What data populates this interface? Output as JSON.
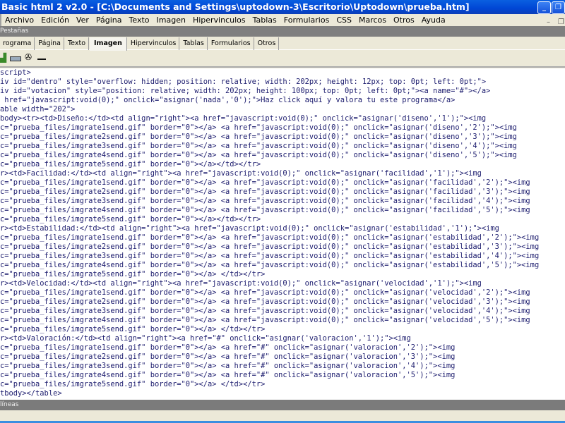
{
  "window": {
    "title": "Basic html 2 v2.0 - [C:\\Documents and Settings\\uptodown-3\\Escritorio\\Uptodown\\prueba.htm]"
  },
  "menu": [
    "Archivo",
    "Edición",
    "Ver",
    "Página",
    "Texto",
    "Imagen",
    "Hipervinculos",
    "Tablas",
    "Formularios",
    "CSS",
    "Marcos",
    "Otros",
    "Ayuda"
  ],
  "panel_title": "Pestañas",
  "tabs": [
    {
      "label": "rograma"
    },
    {
      "label": "Página"
    },
    {
      "label": "Texto"
    },
    {
      "label": "Imagen",
      "active": true
    },
    {
      "label": "Hipervinculos"
    },
    {
      "label": "Tablas"
    },
    {
      "label": "Formularios"
    },
    {
      "label": "Otros"
    }
  ],
  "toolbar_icons": [
    "insert-image-icon",
    "button-icon",
    "camera-icon",
    "horizontal-rule-icon"
  ],
  "code_lines": [
    "script>",
    "iv id=\"dentro\" style=\"overflow: hidden; position: relative; width: 202px; height: 12px; top: 0pt; left: 0pt;\">",
    "iv id=\"votacion\" style=\"position: relative; width: 202px; height: 100px; top: 0pt; left: 0pt;\"><a name=\"#\"></a>",
    " href=\"javascript:void(0);\" onclick=\"asignar('nada','0');\">Haz click aquí y valora tu este programa</a>",
    "able width=\"202\">",
    "body><tr><td>Diseño:</td><td align=\"right\"><a href=\"javascript:void(0);\" onclick=\"asignar('diseno','1');\"><img",
    "c=\"prueba_files/imgrate1send.gif\" border=\"0\"></a> <a href=\"javascript:void(0);\" onclick=\"asignar('diseno','2');\"><img",
    "c=\"prueba_files/imgrate2send.gif\" border=\"0\"></a> <a href=\"javascript:void(0);\" onclick=\"asignar('diseno','3');\"><img",
    "c=\"prueba_files/imgrate3send.gif\" border=\"0\"></a> <a href=\"javascript:void(0);\" onclick=\"asignar('diseno','4');\"><img",
    "c=\"prueba_files/imgrate4send.gif\" border=\"0\"></a> <a href=\"javascript:void(0);\" onclick=\"asignar('diseno','5');\"><img",
    "c=\"prueba_files/imgrate5send.gif\" border=\"0\"></a></td></tr>",
    "r><td>Facilidad:</td><td align=\"right\"><a href=\"javascript:void(0);\" onclick=\"asignar('facilidad','1');\"><img",
    "c=\"prueba_files/imgrate1send.gif\" border=\"0\"></a> <a href=\"javascript:void(0);\" onclick=\"asignar('facilidad','2');\"><img",
    "c=\"prueba_files/imgrate2send.gif\" border=\"0\"></a> <a href=\"javascript:void(0);\" onclick=\"asignar('facilidad','3');\"><img",
    "c=\"prueba_files/imgrate3send.gif\" border=\"0\"></a> <a href=\"javascript:void(0);\" onclick=\"asignar('facilidad','4');\"><img",
    "c=\"prueba_files/imgrate4send.gif\" border=\"0\"></a> <a href=\"javascript:void(0);\" onclick=\"asignar('facilidad','5');\"><img",
    "c=\"prueba_files/imgrate5send.gif\" border=\"0\"></a></td></tr>",
    "r><td>Estabilidad:</td><td align=\"right\"><a href=\"javascript:void(0);\" onclick=\"asignar('estabilidad','1');\"><img",
    "c=\"prueba_files/imgrate1send.gif\" border=\"0\"></a> <a href=\"javascript:void(0);\" onclick=\"asignar('estabilidad','2');\"><img",
    "c=\"prueba_files/imgrate2send.gif\" border=\"0\"></a> <a href=\"javascript:void(0);\" onclick=\"asignar('estabilidad','3');\"><img",
    "c=\"prueba_files/imgrate3send.gif\" border=\"0\"></a> <a href=\"javascript:void(0);\" onclick=\"asignar('estabilidad','4');\"><img",
    "c=\"prueba_files/imgrate4send.gif\" border=\"0\"></a> <a href=\"javascript:void(0);\" onclick=\"asignar('estabilidad','5');\"><img",
    "c=\"prueba_files/imgrate5send.gif\" border=\"0\"></a> </td></tr>",
    "r><td>Velocidad:</td><td align=\"right\"><a href=\"javascript:void(0);\" onclick=\"asignar('velocidad','1');\"><img",
    "c=\"prueba_files/imgrate1send.gif\" border=\"0\"></a> <a href=\"javascript:void(0);\" onclick=\"asignar('velocidad','2');\"><img",
    "c=\"prueba_files/imgrate2send.gif\" border=\"0\"></a> <a href=\"javascript:void(0);\" onclick=\"asignar('velocidad','3');\"><img",
    "c=\"prueba_files/imgrate3send.gif\" border=\"0\"></a> <a href=\"javascript:void(0);\" onclick=\"asignar('velocidad','4');\"><img",
    "c=\"prueba_files/imgrate4send.gif\" border=\"0\"></a> <a href=\"javascript:void(0);\" onclick=\"asignar('velocidad','5');\"><img",
    "c=\"prueba_files/imgrate5send.gif\" border=\"0\"></a> </td></tr>",
    "r><td>Valoración:</td><td align=\"right\"><a href=\"#\" onclick=\"asignar('valoracion','1');\"><img",
    "c=\"prueba_files/imgrate1send.gif\" border=\"0\"></a> <a href=\"#\" onclick=\"asignar('valoracion','2');\"><img",
    "c=\"prueba_files/imgrate2send.gif\" border=\"0\"></a> <a href=\"#\" onclick=\"asignar('valoracion','3');\"><img",
    "c=\"prueba_files/imgrate3send.gif\" border=\"0\"></a> <a href=\"#\" onclick=\"asignar('valoracion','4');\"><img",
    "c=\"prueba_files/imgrate4send.gif\" border=\"0\"></a> <a href=\"#\" onclick=\"asignar('valoracion','5');\"><img",
    "c=\"prueba_files/imgrate5send.gif\" border=\"0\"></a> </td></tr>",
    "tbody></table>"
  ],
  "status": {
    "text": "líneas"
  }
}
